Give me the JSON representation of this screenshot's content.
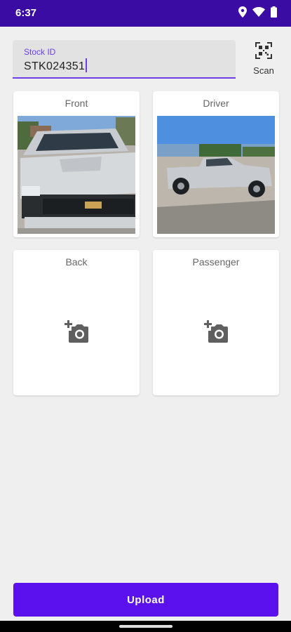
{
  "status_bar": {
    "time": "6:37"
  },
  "stock": {
    "label": "Stock ID",
    "value": "STK024351"
  },
  "scan": {
    "label": "Scan"
  },
  "photos": [
    {
      "label": "Front"
    },
    {
      "label": "Driver"
    },
    {
      "label": "Back"
    },
    {
      "label": "Passenger"
    }
  ],
  "upload": {
    "label": "Upload"
  },
  "colors": {
    "status_bar": "#3a0ca3",
    "accent": "#6d3fe8",
    "button": "#5b11ee",
    "background": "#efefef"
  }
}
